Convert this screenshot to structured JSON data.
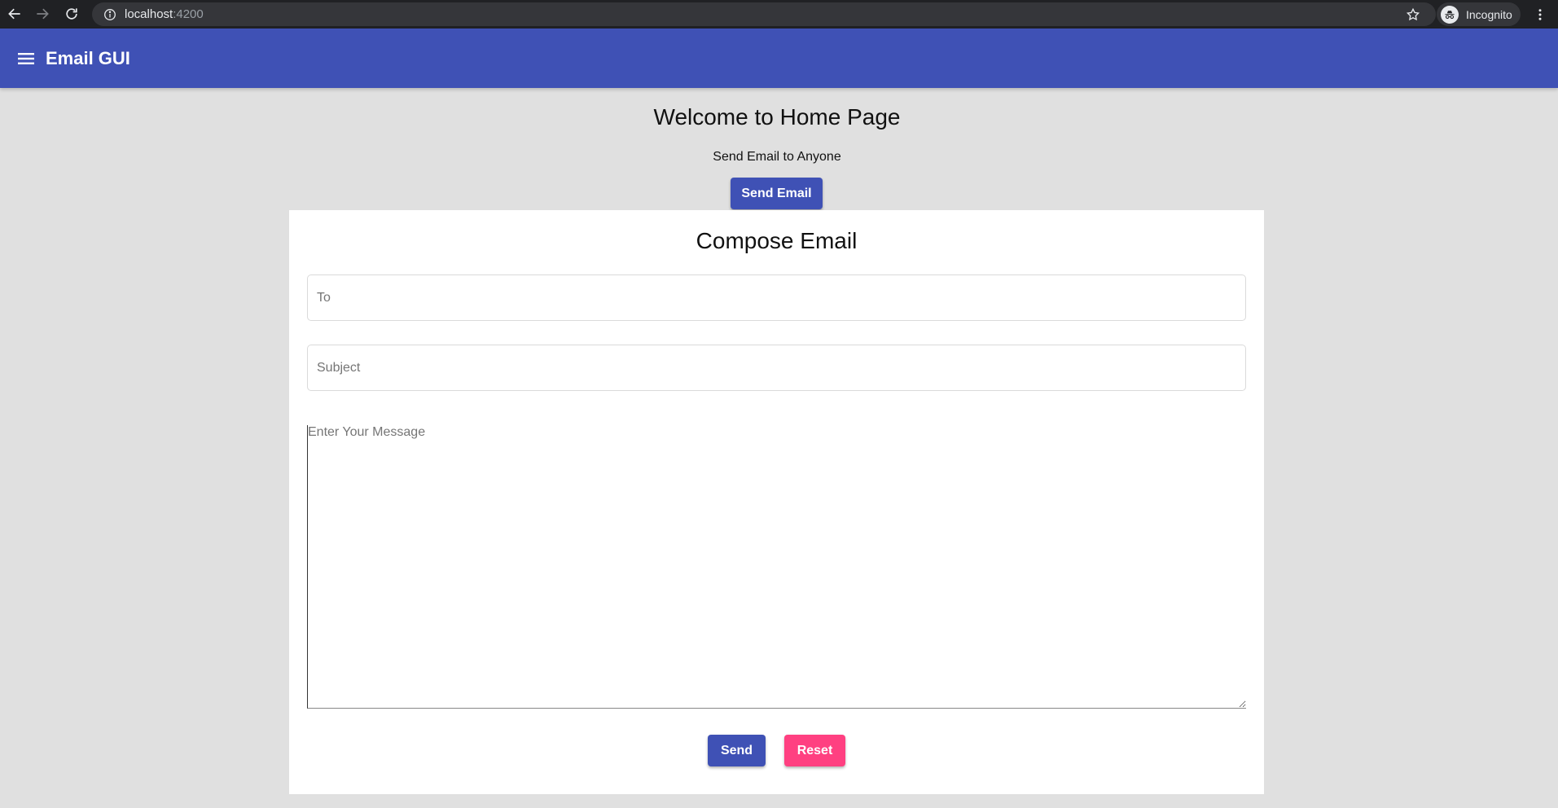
{
  "browser": {
    "url_host": "localhost",
    "url_port": ":4200",
    "profile_label": "Incognito"
  },
  "toolbar": {
    "title": "Email GUI"
  },
  "home": {
    "title": "Welcome to Home Page",
    "subtitle": "Send Email to Anyone",
    "send_email_label": "Send Email"
  },
  "compose": {
    "title": "Compose Email",
    "to_placeholder": "To",
    "subject_placeholder": "Subject",
    "message_placeholder": "Enter Your Message",
    "send_label": "Send",
    "reset_label": "Reset"
  },
  "colors": {
    "primary": "#3f51b5",
    "accent": "#ff4081",
    "background": "#e0e0e0"
  }
}
